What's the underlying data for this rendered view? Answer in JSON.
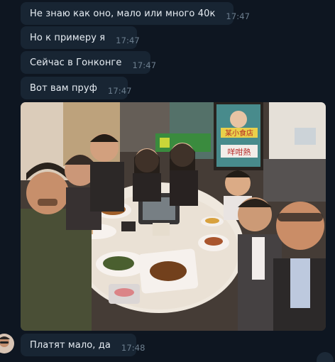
{
  "messages": [
    {
      "text": "Не знаю как оно, мало или много 40к",
      "time": "17:47"
    },
    {
      "text": "Но к примеру я",
      "time": "17:47"
    },
    {
      "text": "Сейчас в Гонконге",
      "time": "17:47"
    },
    {
      "text": "Вот вам пруф",
      "time": "17:47"
    },
    {
      "text": "Платят мало, да",
      "time": "17:48"
    }
  ],
  "photo": {
    "poster_text_top": "某小食店",
    "poster_text_bottom": "咩咁熱"
  },
  "colors": {
    "background": "#0e1621",
    "bubble": "#182533",
    "text": "#e8eef4",
    "time": "#6d7f8f"
  }
}
